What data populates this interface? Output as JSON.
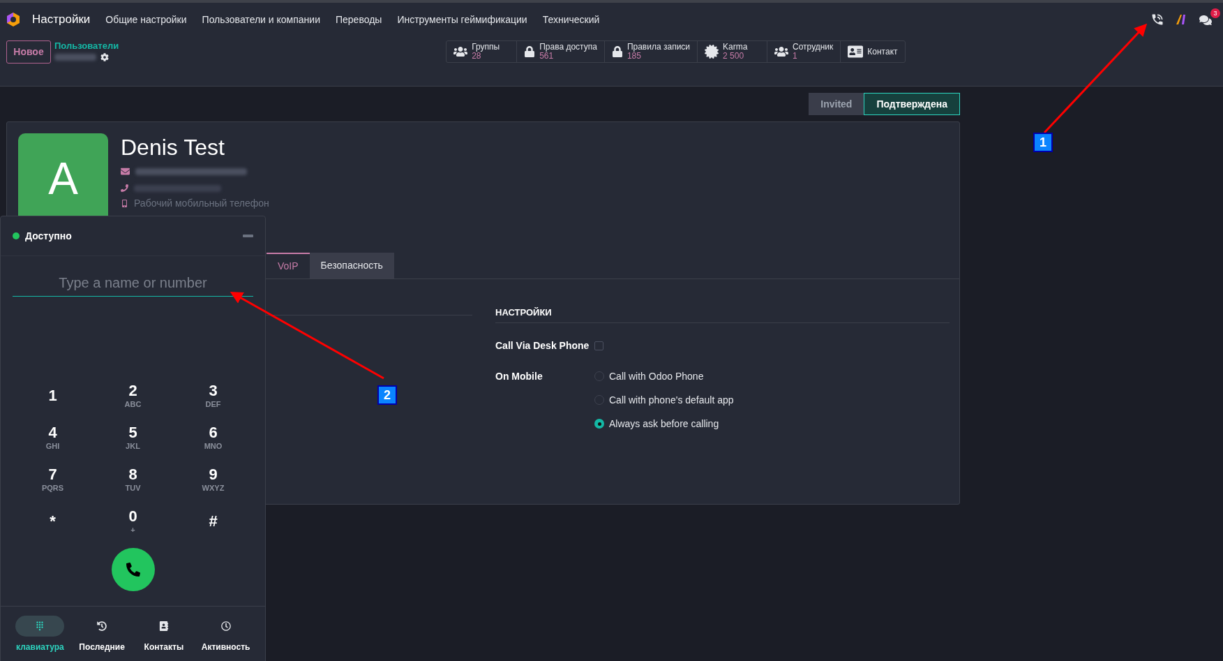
{
  "app": {
    "title": "Настройки"
  },
  "menu": [
    "Общие настройки",
    "Пользователи и компании",
    "Переводы",
    "Инструменты геймификации",
    "Технический"
  ],
  "systray": {
    "chat_badge": "3"
  },
  "control_panel": {
    "new_button": "Новое",
    "breadcrumb": "Пользователи"
  },
  "smart_buttons": [
    {
      "kind": "group",
      "label": "Группы",
      "value": "28"
    },
    {
      "kind": "lock",
      "label": "Права доступа",
      "value": "561"
    },
    {
      "kind": "lock",
      "label": "Правила записи",
      "value": "185"
    },
    {
      "kind": "karma",
      "label": "Karma",
      "value": "2 500"
    },
    {
      "kind": "group",
      "label": "Сотрудник",
      "value": "1"
    },
    {
      "kind": "card",
      "label": "Контакт"
    }
  ],
  "statusbar": [
    {
      "label": "Invited",
      "selected": false
    },
    {
      "label": "Подтверждена",
      "selected": true
    }
  ],
  "profile": {
    "avatar_letter": "A",
    "name": "Denis Test",
    "mobile_placeholder": "Рабочий мобильный телефон"
  },
  "tabs": [
    {
      "label": "VoIP",
      "selected": true
    },
    {
      "label": "Безопасность",
      "selected": false
    }
  ],
  "settings": {
    "heading": "НАСТРОЙКИ",
    "desk_phone": {
      "label": "Call Via Desk Phone",
      "checked": false
    },
    "on_mobile": {
      "label": "On Mobile",
      "options": [
        {
          "label": "Call with Odoo Phone",
          "selected": false
        },
        {
          "label": "Call with phone's default app",
          "selected": false
        },
        {
          "label": "Always ask before calling",
          "selected": true
        }
      ]
    }
  },
  "dialer": {
    "status": "Доступно",
    "online": true,
    "placeholder": "Type a name or number",
    "keys": [
      {
        "digit": "1"
      },
      {
        "digit": "2",
        "letters": "ABC"
      },
      {
        "digit": "3",
        "letters": "DEF"
      },
      {
        "digit": "4",
        "letters": "GHI"
      },
      {
        "digit": "5",
        "letters": "JKL"
      },
      {
        "digit": "6",
        "letters": "MNO"
      },
      {
        "digit": "7",
        "letters": "PQRS"
      },
      {
        "digit": "8",
        "letters": "TUV"
      },
      {
        "digit": "9",
        "letters": "WXYZ"
      },
      {
        "digit": "*"
      },
      {
        "digit": "0",
        "letters": "+"
      },
      {
        "digit": "#"
      }
    ],
    "nav": [
      {
        "kind": "keypad",
        "label": "клавиатура",
        "selected": true
      },
      {
        "kind": "recent",
        "label": "Последние",
        "selected": false
      },
      {
        "kind": "contacts",
        "label": "Контакты",
        "selected": false
      },
      {
        "kind": "activity",
        "label": "Активность",
        "selected": false
      }
    ]
  },
  "annotations": [
    {
      "number": "1"
    },
    {
      "number": "2"
    }
  ]
}
